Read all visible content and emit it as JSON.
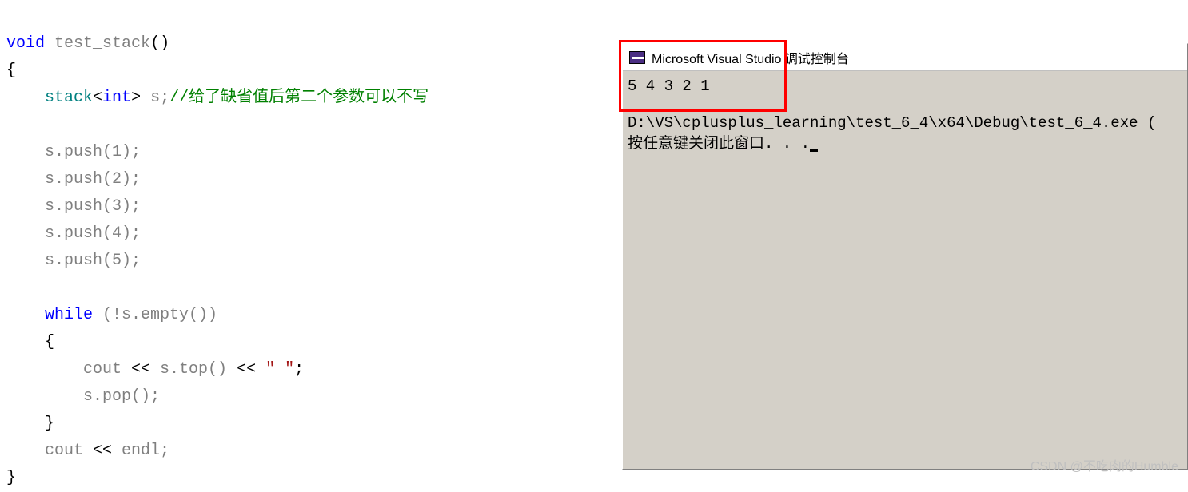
{
  "code": {
    "line1_kw1": "void",
    "line1_fn": "test_stack",
    "line1_paren": "()",
    "line2_brace": "{",
    "line3_kw1": "stack",
    "line3_lt": "<",
    "line3_kw2": "int",
    "line3_gt": ">",
    "line3_var": " s;",
    "line3_comment": "//给了缺省值后第二个参数可以不写",
    "line5": "s.push(1);",
    "line6": "s.push(2);",
    "line7": "s.push(3);",
    "line8": "s.push(4);",
    "line9": "s.push(5);",
    "line11_kw": "while",
    "line11_rest": " (!s.empty())",
    "line12": "{",
    "line13_a": "cout ",
    "line13_op1": "<<",
    "line13_b": " s.top() ",
    "line13_op2": "<<",
    "line13_spc": " ",
    "line13_str": "\" \"",
    "line13_end": ";",
    "line14": "s.pop();",
    "line15": "}",
    "line16_a": "cout ",
    "line16_op": "<<",
    "line16_b": " endl;",
    "line17": "}"
  },
  "console": {
    "title": "Microsoft Visual Studio 调试控制台",
    "output": "5 4 3 2 1",
    "path": "D:\\VS\\cplusplus_learning\\test_6_4\\x64\\Debug\\test_6_4.exe (",
    "prompt": "按任意键关闭此窗口. . ."
  },
  "watermark": "CSDN @不吃肉的Humble"
}
